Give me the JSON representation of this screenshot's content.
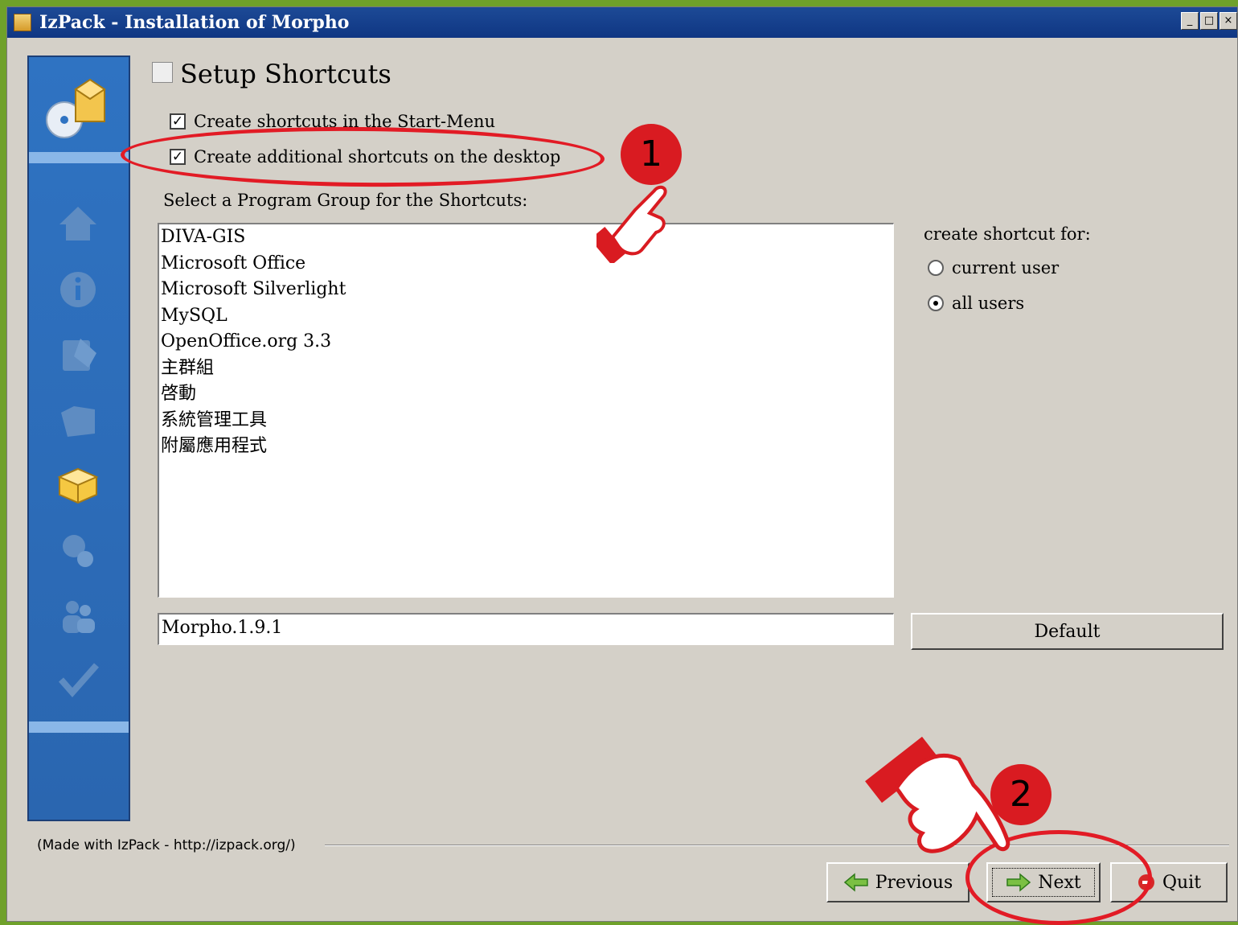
{
  "window": {
    "title": "IzPack - Installation of Morpho",
    "controls": [
      "_",
      "□",
      "×"
    ]
  },
  "panel": {
    "title": "Setup Shortcuts",
    "checkbox_start_menu": "Create shortcuts in the Start-Menu",
    "checkbox_start_menu_checked": true,
    "checkbox_desktop": "Create additional shortcuts on the desktop",
    "checkbox_desktop_checked": true,
    "program_group_label": "Select a Program Group for the Shortcuts:",
    "program_groups": [
      "DIVA-GIS",
      "Microsoft Office",
      "Microsoft Silverlight",
      "MySQL",
      "OpenOffice.org 3.3",
      "主群組",
      "啓動",
      "系統管理工具",
      "附屬應用程式"
    ],
    "group_name_value": "Morpho.1.9.1",
    "default_button": "Default",
    "create_for_label": "create shortcut for:",
    "radio_current_user": "current user",
    "radio_all_users": "all users",
    "selected_radio": "all users"
  },
  "footer": {
    "made_with": "(Made with IzPack - http://izpack.org/)",
    "previous": "Previous",
    "next": "Next",
    "quit": "Quit"
  },
  "annotations": {
    "step1": "1",
    "step2": "2"
  },
  "colors": {
    "annotation_red": "#e21b25",
    "titlebar_blue": "#0f3683",
    "sidebar_blue": "#2f73c2"
  }
}
